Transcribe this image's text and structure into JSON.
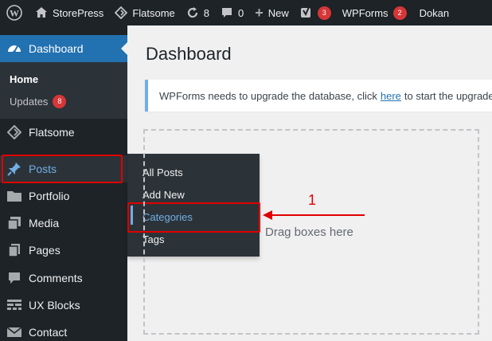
{
  "admin_bar": {
    "items": [
      {
        "label": "StorePress",
        "icon": "home-icon"
      },
      {
        "label": "Flatsome",
        "icon": "flatsome-icon"
      },
      {
        "label": "8",
        "icon": "refresh-icon"
      },
      {
        "label": "0",
        "icon": "comment-icon"
      },
      {
        "label": "New",
        "icon": "plus-icon"
      },
      {
        "label": "",
        "badge": "3",
        "icon": "yoast-icon"
      },
      {
        "label": "WPForms",
        "badge": "2"
      },
      {
        "label": "Dokan"
      }
    ]
  },
  "sidebar": {
    "dashboard_label": "Dashboard",
    "submenu": {
      "home": "Home",
      "updates": "Updates",
      "updates_badge": "8"
    },
    "items": [
      {
        "label": "Flatsome",
        "icon": "flatsome-diamond-icon"
      },
      {
        "label": "Posts",
        "icon": "pushpin-icon"
      },
      {
        "label": "Portfolio",
        "icon": "folder-icon"
      },
      {
        "label": "Media",
        "icon": "media-icon"
      },
      {
        "label": "Pages",
        "icon": "pages-icon"
      },
      {
        "label": "Comments",
        "icon": "comments-icon"
      },
      {
        "label": "UX Blocks",
        "icon": "blocks-icon"
      },
      {
        "label": "Contact",
        "icon": "mail-icon"
      }
    ]
  },
  "flyout": {
    "items": [
      "All Posts",
      "Add New",
      "Categories",
      "Tags"
    ],
    "active_index": 2
  },
  "main": {
    "title": "Dashboard",
    "notice": {
      "before": "WPForms needs to upgrade the database, click",
      "link": "here",
      "after": "to start the upgrade."
    },
    "dropzone_label": "Drag boxes here"
  },
  "annotation": {
    "number": "1"
  },
  "colors": {
    "accent": "#2271b1",
    "highlight": "#e00000",
    "sidebar": "#1d2327",
    "badge": "#d63638"
  }
}
